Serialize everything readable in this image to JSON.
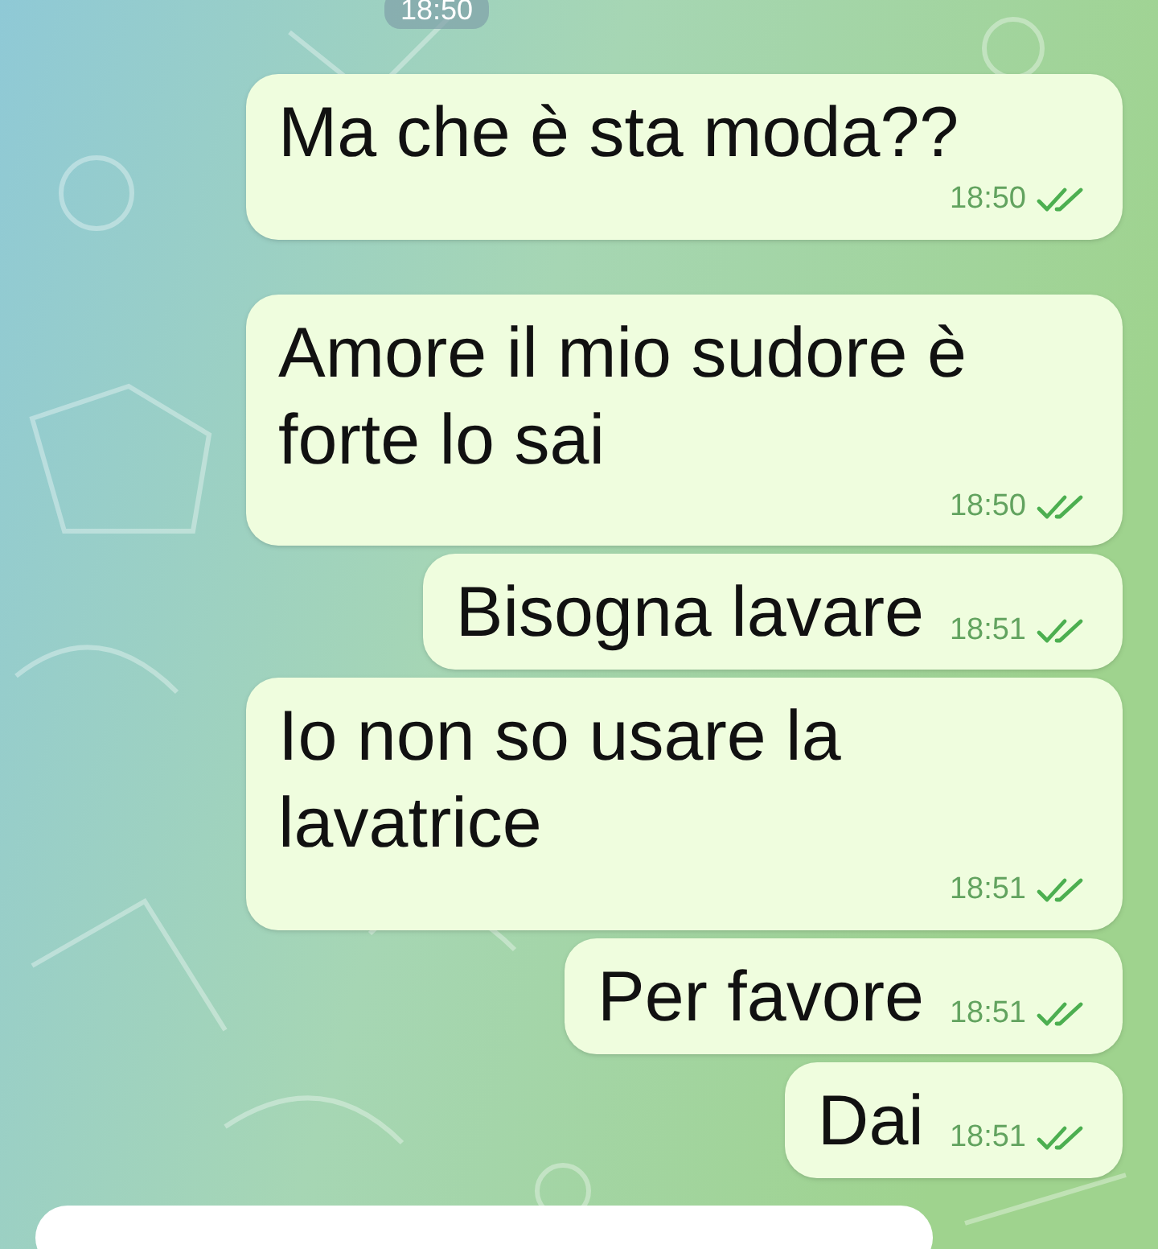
{
  "date_pill": "18:50",
  "messages": [
    {
      "text": "Ma che è sta moda??",
      "time": "18:50",
      "read": true
    },
    {
      "text": "Amore il mio sudore è forte lo sai",
      "time": "18:50",
      "read": true
    },
    {
      "text": "Bisogna lavare",
      "time": "18:51",
      "read": true
    },
    {
      "text": "Io non so usare la lavatrice",
      "time": "18:51",
      "read": true
    },
    {
      "text": "Per favore",
      "time": "18:51",
      "read": true
    },
    {
      "text": "Dai",
      "time": "18:51",
      "read": true
    }
  ]
}
